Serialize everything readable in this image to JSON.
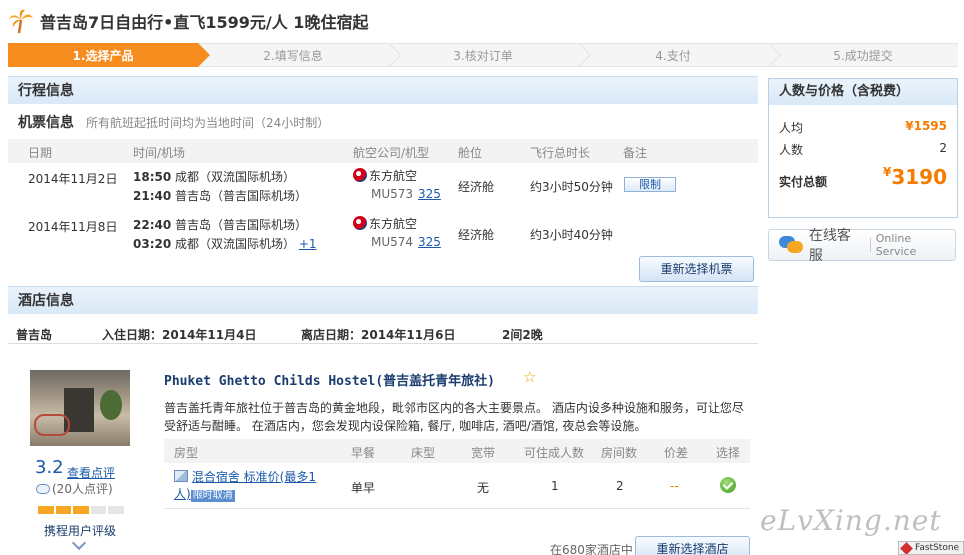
{
  "page": {
    "title": "普吉岛7日自由行•直飞1599元/人 1晚住宿起",
    "logo_icon": "palm-tree-icon"
  },
  "steps": [
    {
      "label": "1.选择产品",
      "active": true
    },
    {
      "label": "2.填写信息",
      "active": false
    },
    {
      "label": "3.核对订单",
      "active": false
    },
    {
      "label": "4.支付",
      "active": false
    },
    {
      "label": "5.成功提交",
      "active": false
    }
  ],
  "itinerary": {
    "section_title": "行程信息",
    "flight_title": "机票信息",
    "flight_note": "所有航班起抵时间均为当地时间（24小时制）",
    "columns": [
      "日期",
      "时间/机场",
      "航空公司/机型",
      "舱位",
      "飞行总时长",
      "备注"
    ],
    "flights": [
      {
        "date": "2014年11月2日",
        "dep_time": "18:50",
        "dep_airport": "成都（双流国际机场）",
        "arr_time": "21:40",
        "arr_airport": "普吉岛（普吉国际机场）",
        "arr_plus": "",
        "airline": "东方航空",
        "flight_no": "MU573",
        "aircraft": "325",
        "cabin": "经济舱",
        "duration": "约3小时50分钟",
        "remark": "限制"
      },
      {
        "date": "2014年11月8日",
        "dep_time": "22:40",
        "dep_airport": "普吉岛（普吉国际机场）",
        "arr_time": "03:20",
        "arr_airport": "成都（双流国际机场）",
        "arr_plus": "+1",
        "airline": "东方航空",
        "flight_no": "MU574",
        "aircraft": "325",
        "cabin": "经济舱",
        "duration": "约3小时40分钟",
        "remark": ""
      }
    ],
    "reselect_flight_label": "重新选择机票"
  },
  "hotel": {
    "section_title": "酒店信息",
    "city": "普吉岛",
    "checkin": "入住日期：2014年11月4日",
    "checkout": "离店日期：2014年11月6日",
    "nights": "2间2晚",
    "name": "Phuket Ghetto Childs Hostel(普吉盖托青年旅社)",
    "description": "普吉盖托青年旅社位于普吉岛的黄金地段，毗邻市区内的各大主要景点。 酒店内设多种设施和服务，可让您尽受舒适与酣睡。 在酒店内，您会发现内设保险箱, 餐厅, 咖啡店, 酒吧/酒馆, 夜总会等设施。",
    "score": "3.2",
    "score_link": "查看点评",
    "reviews": "(20人点评)",
    "rating_label": "携程用户评级",
    "rating_fraction": 0.6,
    "room_columns": [
      "房型",
      "早餐",
      "床型",
      "宽带",
      "可住成人数",
      "房间数",
      "价差",
      "选择"
    ],
    "rooms": [
      {
        "type": "混合宿舍 标准价(最多1人)",
        "tag": "限时取消",
        "breakfast": "单早",
        "bed": "",
        "internet": "无",
        "adults": "1",
        "rooms": "2",
        "price_diff": "--"
      }
    ],
    "hotel_count": "在680家酒店中",
    "reselect_hotel_label": "重新选择酒店"
  },
  "side": {
    "title": "人数与价格（含税费）",
    "per_person_label": "人均",
    "per_person_value": "¥1595",
    "people_label": "人数",
    "people_value": "2",
    "total_label": "实付总额",
    "total_currency": "¥",
    "total_value": "3190"
  },
  "service": {
    "label_cn": "在线客服",
    "label_en": "Online Service"
  },
  "watermark": "eLvXing.net",
  "taskbar": "FastStone",
  "colors": {
    "accent": "#f68c1e",
    "link": "#1a5aa8",
    "price": "#f57c00"
  }
}
